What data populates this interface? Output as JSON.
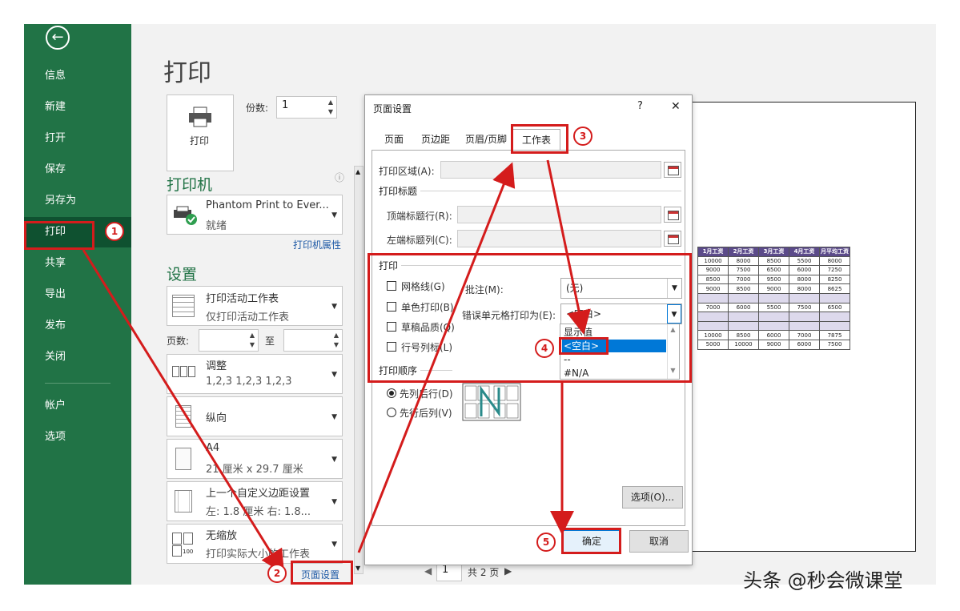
{
  "sidebar": {
    "back_icon": "arrow-left-circle-icon",
    "items": [
      "信息",
      "新建",
      "打开",
      "保存",
      "另存为",
      "打印",
      "共享",
      "导出",
      "发布",
      "关闭",
      "帐户",
      "选项"
    ],
    "selected": "打印"
  },
  "print": {
    "title": "打印",
    "copies_label": "份数:",
    "copies_value": "1",
    "print_button": "打印",
    "printer_heading": "打印机",
    "printer_name": "Phantom Print to Ever...",
    "printer_status": "就绪",
    "printer_props": "打印机属性",
    "settings_heading": "设置",
    "scope_title": "打印活动工作表",
    "scope_sub": "仅打印活动工作表",
    "pages_label": "页数:",
    "pages_to": "至",
    "collate_title": "调整",
    "collate_sub": "1,2,3    1,2,3    1,2,3",
    "orientation": "纵向",
    "paper_title": "A4",
    "paper_sub": "21 厘米 x 29.7 厘米",
    "margins_title": "上一个自定义边距设置",
    "margins_sub": "左: 1.8 厘米    右: 1.8...",
    "scaling_title": "无缩放",
    "scaling_sub": "打印实际大小的工作表",
    "page_setup_link": "页面设置",
    "page_nav_current": "1",
    "page_nav_total": "共 2 页"
  },
  "dialog": {
    "title": "页面设置",
    "help": "?",
    "close": "✕",
    "tabs": [
      "页面",
      "页边距",
      "页眉/页脚",
      "工作表"
    ],
    "active_tab": "工作表",
    "print_area_label": "打印区域(A):",
    "print_titles_group": "打印标题",
    "top_rows_label": "顶端标题行(R):",
    "left_cols_label": "左端标题列(C):",
    "print_group": "打印",
    "gridlines": "网格线(G)",
    "bw": "单色打印(B)",
    "draft": "草稿品质(Q)",
    "headings": "行号列标(L)",
    "comments_label": "批注(M):",
    "comments_value": "(无)",
    "errors_label": "错误单元格打印为(E):",
    "errors_value": "<空白>",
    "error_options": [
      "显示值",
      "<空白>",
      "--",
      "#N/A"
    ],
    "error_selected": "<空白>",
    "order_group": "打印顺序",
    "order_down": "先列后行(D)",
    "order_over": "先行后列(V)",
    "options_button": "选项(O)...",
    "ok_button": "确定",
    "cancel_button": "取消"
  },
  "preview_table": {
    "headers": [
      "1月工资",
      "2月工资",
      "3月工资",
      "4月工资",
      "月平均工资"
    ],
    "rows": [
      [
        "10000",
        "8000",
        "8500",
        "5500",
        "8000"
      ],
      [
        "9000",
        "7500",
        "6500",
        "6000",
        "7250"
      ],
      [
        "8500",
        "7000",
        "9500",
        "8000",
        "8250"
      ],
      [
        "9000",
        "8500",
        "9000",
        "8000",
        "8625"
      ],
      [
        "",
        "",
        "",
        "",
        ""
      ],
      [
        "7000",
        "6000",
        "5500",
        "7500",
        "6500"
      ],
      [
        "",
        "",
        "",
        "",
        ""
      ],
      [
        "",
        "",
        "",
        "",
        ""
      ],
      [
        "10000",
        "8500",
        "6000",
        "7000",
        "7875"
      ],
      [
        "5000",
        "10000",
        "9000",
        "6000",
        "7500"
      ]
    ]
  },
  "annotations": {
    "badges": [
      "1",
      "2",
      "3",
      "4",
      "5"
    ],
    "color": "#d41c1c"
  },
  "watermark": "头条 @秒会微课堂",
  "colors": {
    "sidebar": "#217346",
    "sidebar_selected": "#0f5130",
    "annotation": "#d41c1c",
    "highlight": "#0078d7"
  }
}
